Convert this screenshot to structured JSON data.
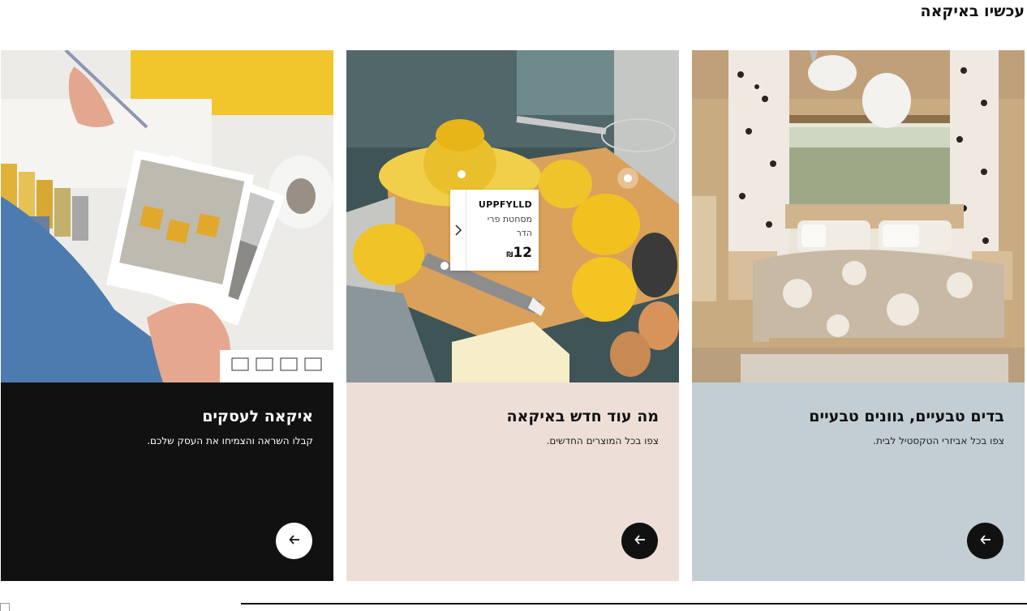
{
  "section": {
    "title": "עכשיו באיקאה"
  },
  "cards": [
    {
      "title": "בדים טבעיים, גוונים טבעיים",
      "subtitle": "צפו בכל אביזרי הטקסטיל לבית.",
      "body_color": "#c2ced4",
      "image_alt": "bedroom",
      "button_icon": "arrow-left-icon"
    },
    {
      "title": "מה עוד חדש באיקאה",
      "subtitle": "צפו בכל המוצרים החדשים.",
      "body_color": "#eddfd7",
      "image_alt": "kitchen",
      "button_icon": "arrow-left-icon",
      "product_tooltip": {
        "name": "UPPFYLLD",
        "description": "מסחטת פרי הדר",
        "price": "12",
        "currency": "₪"
      }
    },
    {
      "title": "איקאה לעסקים",
      "subtitle": "קבלו השראה והצמיחו את העסק שלכם.",
      "body_color": "#111111",
      "image_alt": "business",
      "button_icon": "arrow-left-icon"
    }
  ]
}
